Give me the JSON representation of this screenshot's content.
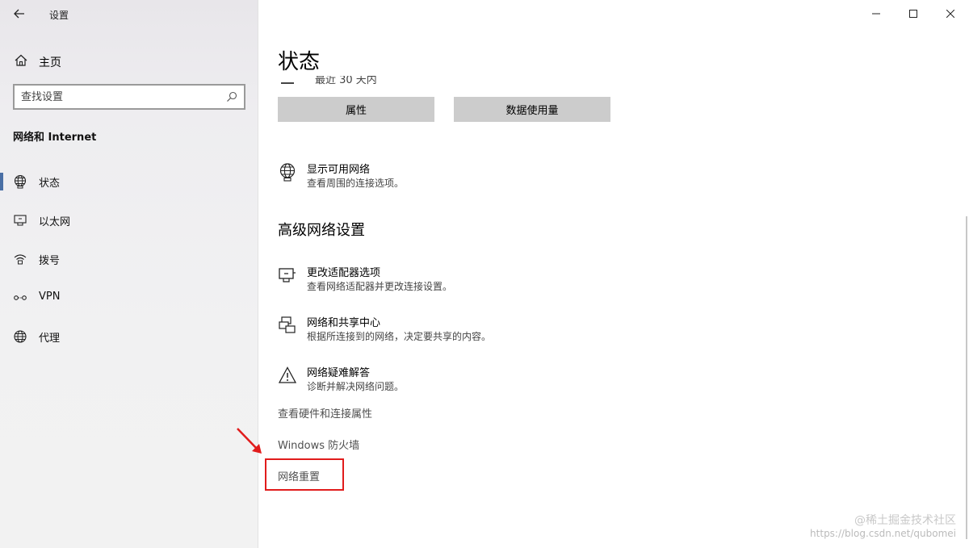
{
  "window": {
    "title": "设置",
    "caption": {
      "minimize": "—",
      "maximize": "☐",
      "close": "✕"
    }
  },
  "sidebar": {
    "home_label": "主页",
    "search_placeholder": "查找设置",
    "section_title": "网络和 Internet",
    "items": [
      {
        "label": "状态",
        "icon": "globe-icon",
        "active": true
      },
      {
        "label": "以太网",
        "icon": "ethernet-icon",
        "active": false
      },
      {
        "label": "拨号",
        "icon": "dialup-icon",
        "active": false
      },
      {
        "label": "VPN",
        "icon": "vpn-icon",
        "active": false
      },
      {
        "label": "代理",
        "icon": "proxy-globe-icon",
        "active": false
      }
    ]
  },
  "main": {
    "page_title": "状态",
    "clipped_text": "最近 30 天内",
    "buttons": {
      "properties": "属性",
      "data_usage": "数据使用量"
    },
    "show_networks": {
      "title": "显示可用网络",
      "desc": "查看周围的连接选项。"
    },
    "advanced_heading": "高级网络设置",
    "advanced_items": [
      {
        "title": "更改适配器选项",
        "desc": "查看网络适配器并更改连接设置。",
        "icon": "adapter-icon"
      },
      {
        "title": "网络和共享中心",
        "desc": "根据所连接到的网络，决定要共享的内容。",
        "icon": "sharing-center-icon"
      },
      {
        "title": "网络疑难解答",
        "desc": "诊断并解决网络问题。",
        "icon": "warning-icon"
      }
    ],
    "links": {
      "hardware": "查看硬件和连接属性",
      "firewall": "Windows 防火墙",
      "reset": "网络重置"
    }
  },
  "annotation": {
    "highlight_color": "#e11c1c"
  },
  "watermark": {
    "line1": "@稀土掘金技术社区",
    "line2": "https://blog.csdn.net/qubomei"
  }
}
